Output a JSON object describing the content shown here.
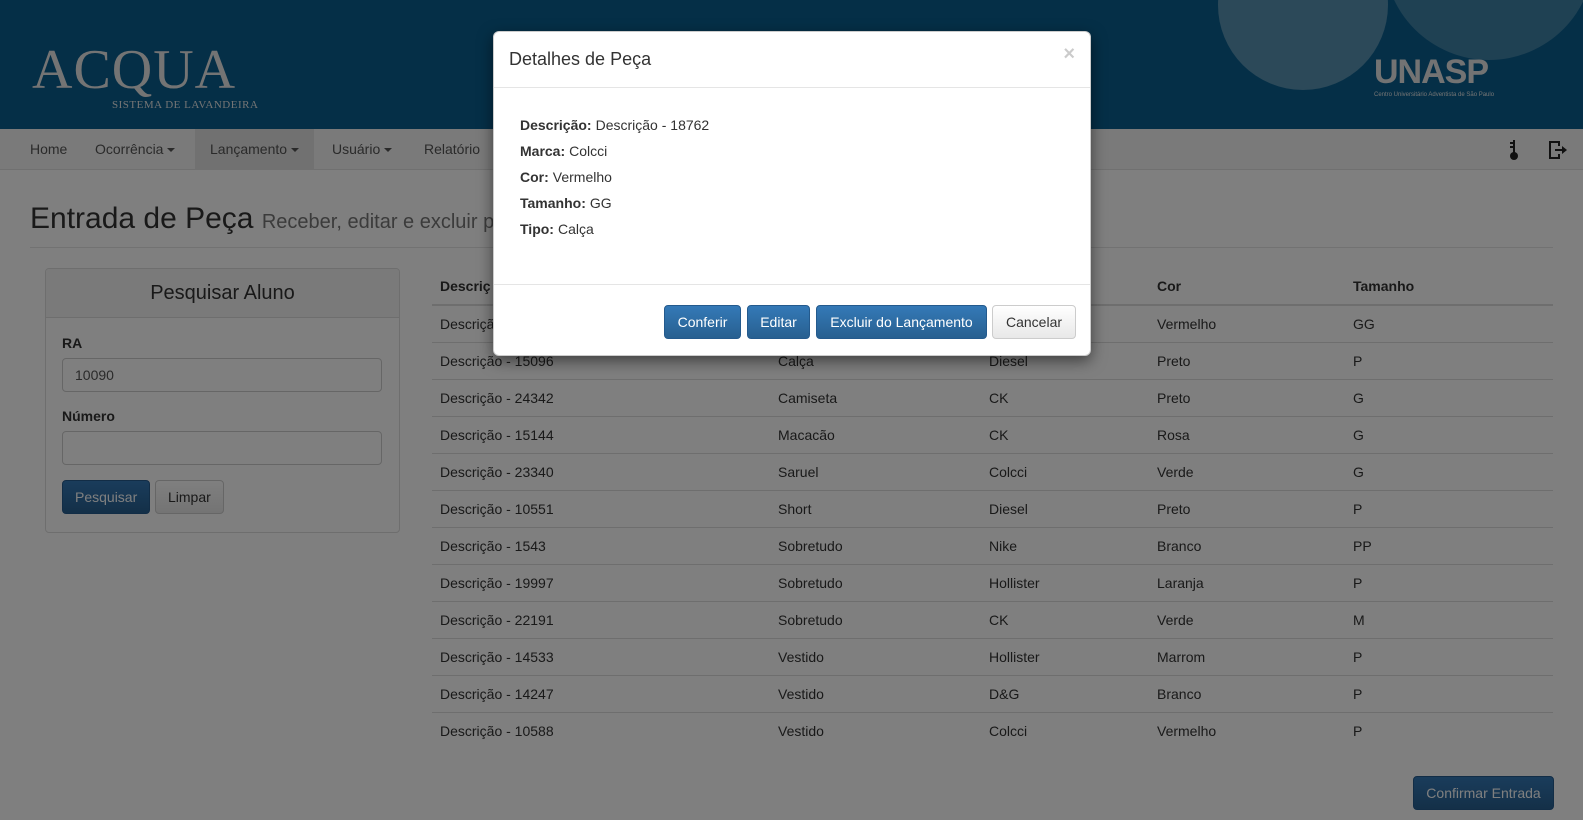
{
  "header": {
    "logo_main": "ACQUA",
    "logo_sub": "SISTEMA DE LAVANDEIRA",
    "partner_logo": "UNASP",
    "partner_sub": "Centro Universitário Adventista de São Paulo"
  },
  "nav": {
    "home": "Home",
    "ocorrencia": "Ocorrência",
    "lancamento": "Lançamento",
    "usuario": "Usuário",
    "relatorio": "Relatório",
    "icons": [
      "key-icon",
      "logout-icon"
    ]
  },
  "page": {
    "title": "Entrada de Peça",
    "subtitle": "Receber, editar e excluir pe"
  },
  "search": {
    "heading": "Pesquisar Aluno",
    "ra_label": "RA",
    "ra_value": "10090",
    "numero_label": "Número",
    "numero_value": "",
    "search_button": "Pesquisar",
    "clear_button": "Limpar"
  },
  "table": {
    "headers": [
      "Descriç",
      "",
      "",
      "Cor",
      "Tamanho"
    ],
    "rows": [
      [
        "Descriçã",
        "",
        "",
        "Vermelho",
        "GG"
      ],
      [
        "Descrição - 15096",
        "Calça",
        "Diesel",
        "Preto",
        "P"
      ],
      [
        "Descrição - 24342",
        "Camiseta",
        "CK",
        "Preto",
        "G"
      ],
      [
        "Descrição - 15144",
        "Macacão",
        "CK",
        "Rosa",
        "G"
      ],
      [
        "Descrição - 23340",
        "Saruel",
        "Colcci",
        "Verde",
        "G"
      ],
      [
        "Descrição - 10551",
        "Short",
        "Diesel",
        "Preto",
        "P"
      ],
      [
        "Descrição - 1543",
        "Sobretudo",
        "Nike",
        "Branco",
        "PP"
      ],
      [
        "Descrição - 19997",
        "Sobretudo",
        "Hollister",
        "Laranja",
        "P"
      ],
      [
        "Descrição - 22191",
        "Sobretudo",
        "CK",
        "Verde",
        "M"
      ],
      [
        "Descrição - 14533",
        "Vestido",
        "Hollister",
        "Marrom",
        "P"
      ],
      [
        "Descrição - 14247",
        "Vestido",
        "D&G",
        "Branco",
        "P"
      ],
      [
        "Descrição - 10588",
        "Vestido",
        "Colcci",
        "Vermelho",
        "P"
      ]
    ]
  },
  "confirm_button": "Confirmar Entrada",
  "modal": {
    "title": "Detalhes de Peça",
    "close": "×",
    "details": [
      {
        "label": "Descrição:",
        "value": "Descrição - 18762"
      },
      {
        "label": "Marca:",
        "value": "Colcci"
      },
      {
        "label": "Cor:",
        "value": "Vermelho"
      },
      {
        "label": "Tamanho:",
        "value": "GG"
      },
      {
        "label": "Tipo:",
        "value": "Calça"
      }
    ],
    "buttons": {
      "conferir": "Conferir",
      "editar": "Editar",
      "excluir": "Excluir do Lançamento",
      "cancelar": "Cancelar"
    }
  },
  "colors": {
    "header_bg": "#0a5f8f",
    "primary": "#286090"
  }
}
